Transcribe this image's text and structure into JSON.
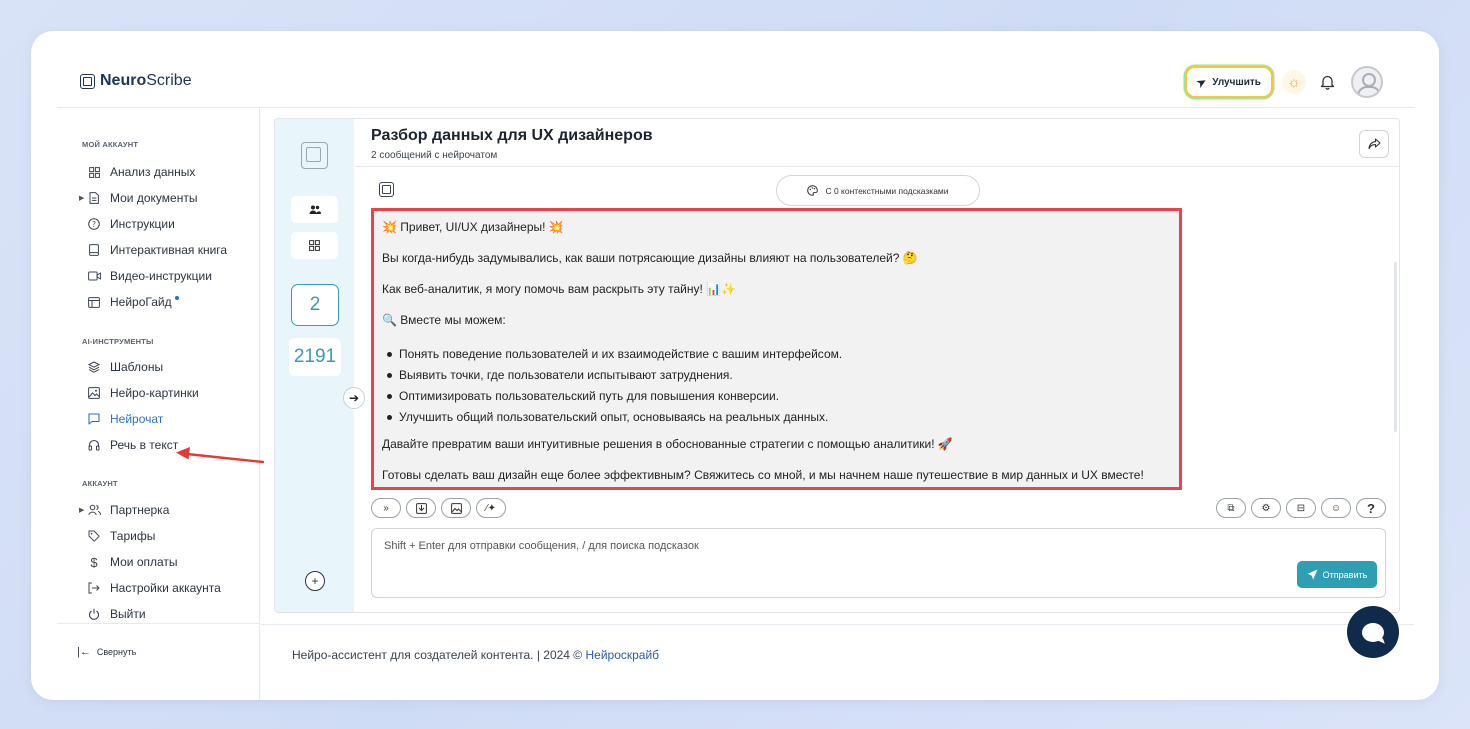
{
  "app": {
    "logo_bold": "Neuro",
    "logo_rest": "Scribe"
  },
  "header": {
    "upgrade_label": "Улучшить"
  },
  "sidebar": {
    "section_account": "МОЙ АККАУНТ",
    "account_items": [
      {
        "label": "Анализ данных",
        "icon": "grid-icon"
      },
      {
        "label": "Мои документы",
        "icon": "document-icon"
      },
      {
        "label": "Инструкции",
        "icon": "help-circle-icon"
      },
      {
        "label": "Интерактивная книга",
        "icon": "book-icon"
      },
      {
        "label": "Видео-инструкции",
        "icon": "video-icon"
      },
      {
        "label": "НейроГайд",
        "icon": "guide-icon"
      }
    ],
    "section_ai": "AI-ИНСТРУМЕНТЫ",
    "ai_items": [
      {
        "label": "Шаблоны",
        "icon": "layers-icon"
      },
      {
        "label": "Нейро-картинки",
        "icon": "image-icon"
      },
      {
        "label": "Нейрочат",
        "icon": "chat-icon"
      },
      {
        "label": "Речь в текст",
        "icon": "headphones-icon"
      }
    ],
    "section_settings": "АККАУНТ",
    "settings_items": [
      {
        "label": "Партнерка",
        "icon": "users-icon"
      },
      {
        "label": "Тарифы",
        "icon": "tag-icon"
      },
      {
        "label": "Мои оплаты",
        "icon": "dollar-icon"
      },
      {
        "label": "Настройки аккаунта",
        "icon": "login-icon"
      },
      {
        "label": "Выйти",
        "icon": "power-icon"
      }
    ],
    "collapse_label": "Свернуть"
  },
  "chat": {
    "title": "Разбор данных для UX дизайнеров",
    "subtitle": "2 сообщений с нейрочатом",
    "context_label": "С 0 контекстными подсказками",
    "rail_number": "2",
    "rail_count": "2191",
    "message": {
      "greeting": "💥 Привет, UI/UX дизайнеры! 💥",
      "line1": "Вы когда-нибудь задумывались, как ваши потрясающие дизайны влияют на пользователей? 🤔",
      "line2": "Как веб-аналитик, я могу помочь вам раскрыть эту тайну! 📊✨",
      "line3": "🔍 Вместе мы можем:",
      "bullets": [
        "Понять поведение пользователей и их взаимодействие с вашим интерфейсом.",
        "Выявить точки, где пользователи испытывают затруднения.",
        "Оптимизировать пользовательский путь для повышения конверсии.",
        "Улучшить общий пользовательский опыт, основываясь на реальных данных."
      ],
      "line4": "Давайте превратим ваши интуитивные решения в обоснованные стратегии с помощью аналитики! 🚀",
      "line5": "Готовы сделать ваш дизайн еще более эффективным? Свяжитесь со мной, и мы начнем наше путешествие в мир данных и UX вместе!"
    },
    "input_placeholder": "Shift + Enter для отправки сообщения, / для поиска подсказок",
    "send_label": "Отправить",
    "help_label": "?"
  },
  "footer": {
    "text": "Нейро-ассистент для создателей контента.  | 2024 © ",
    "link": "Нейроскрайб"
  },
  "colors": {
    "accent": "#2e9fb3",
    "active_nav": "#2a72c4",
    "highlight_border": "#e8434a",
    "rail_bg": "#e8f5fb"
  }
}
